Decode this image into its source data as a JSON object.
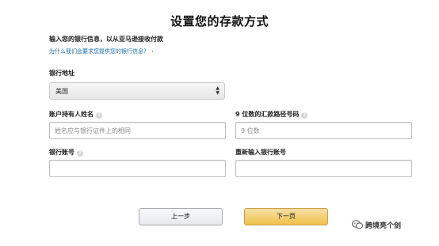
{
  "page": {
    "title": "设置您的存款方式",
    "intro": "输入您的银行信息，以从亚马逊接收付款",
    "why_link": "为什么我们会要求您提供您的银行信息？",
    "why_link_icon": "chevron-right-icon"
  },
  "form": {
    "bank_location": {
      "label": "银行地址",
      "value": "美国"
    },
    "account_holder": {
      "label": "账户持有人姓名",
      "placeholder": "姓名应与银行证件上的相同",
      "value": ""
    },
    "routing_number": {
      "label": "9 位数的汇款路径号码",
      "placeholder": "9 位数",
      "value": ""
    },
    "account_number": {
      "label": "银行账号",
      "value": ""
    },
    "account_number_confirm": {
      "label": "重新输入银行账号",
      "value": ""
    },
    "help_icon": "help-icon"
  },
  "buttons": {
    "prev": "上一步",
    "next": "下一页"
  },
  "watermark": {
    "text": "跨境亮个剑",
    "icon": "wechat-icon"
  },
  "colors": {
    "link": "#1a6fb3",
    "next_button": "#f0c14b",
    "prev_button": "#e7e9ec"
  }
}
